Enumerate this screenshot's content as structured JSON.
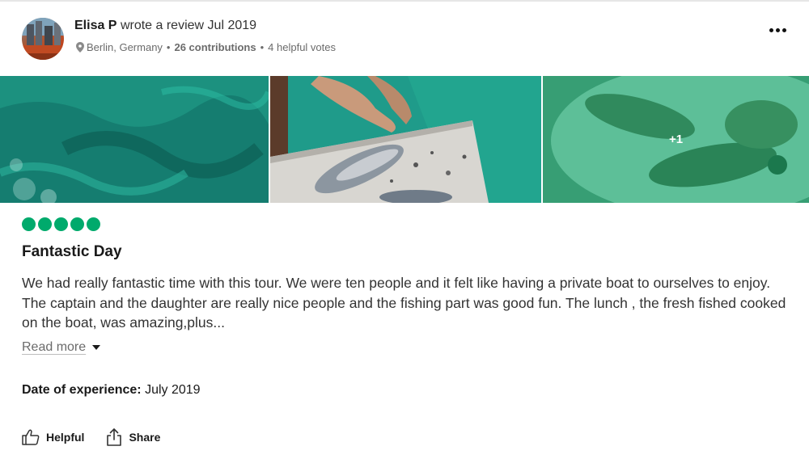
{
  "review": {
    "author": "Elisa P",
    "action_text": "wrote a review",
    "date": "Jul 2019",
    "location": "Berlin, Germany",
    "contributions": "26 contributions",
    "helpful_votes": "4 helpful votes",
    "separator": "•",
    "photos_extra": "+1",
    "rating": 5,
    "rating_max": 5,
    "title": "Fantastic Day",
    "body": "We had really fantastic time with this tour. We were ten people and it felt like having a private boat to ourselves to enjoy. The captain and the daughter are really nice people and the fishing part was good fun. The lunch , the fresh fished cooked on the boat, was amazing,plus...",
    "read_more": "Read more",
    "date_of_experience_label": "Date of experience:",
    "date_of_experience_value": "July 2019"
  },
  "actions": {
    "helpful": "Helpful",
    "share": "Share"
  },
  "icons": {
    "more": "more-options-icon",
    "location": "location-pin-icon",
    "helpful": "thumbs-up-icon",
    "share": "share-icon",
    "caret": "caret-down-icon"
  },
  "colors": {
    "rating_bubble": "#00aa6c",
    "photo_overlay": "#00af69"
  }
}
